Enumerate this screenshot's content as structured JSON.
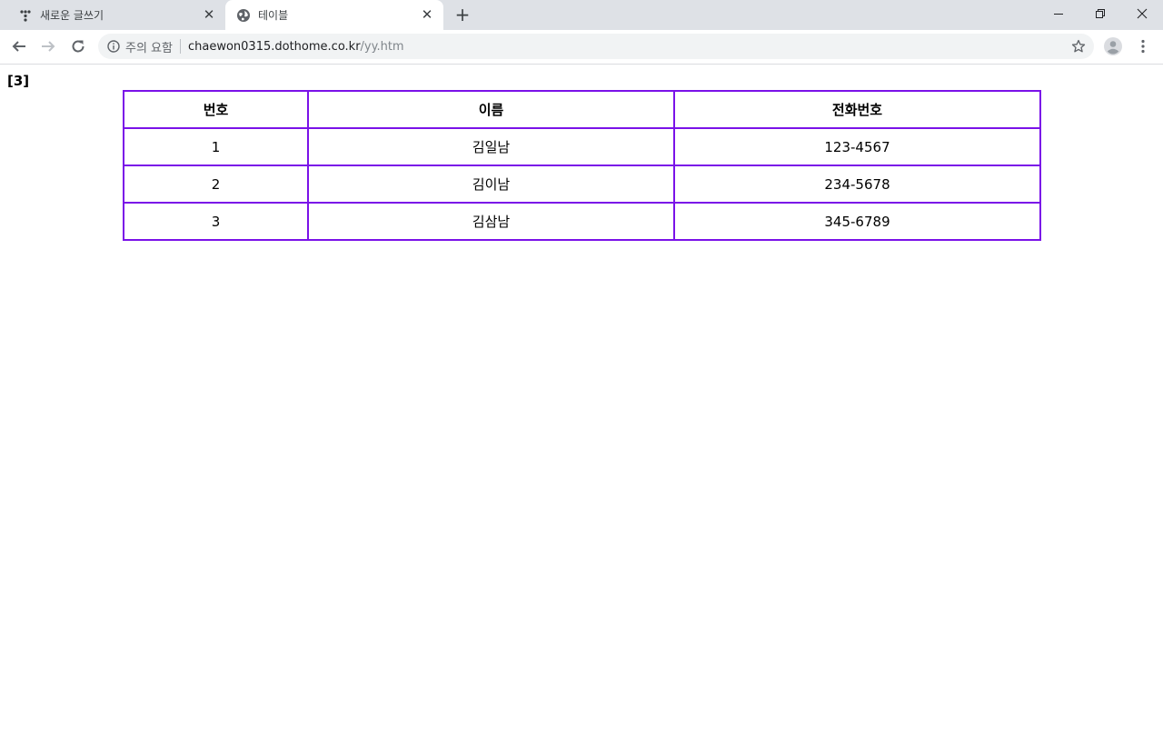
{
  "browser": {
    "tabs": [
      {
        "title": "새로운 글쓰기",
        "favicon": "tistory-icon",
        "active": false
      },
      {
        "title": "테이블",
        "favicon": "globe-icon",
        "active": true
      }
    ],
    "new_tab_label": "+",
    "url_security_text": "주의 요함",
    "url_host": "chaewon0315.dothome.co.kr",
    "url_path": "/yy.htm"
  },
  "page": {
    "label": "[3]",
    "table": {
      "headers": [
        "번호",
        "이름",
        "전화번호"
      ],
      "rows": [
        [
          "1",
          "김일남",
          "123-4567"
        ],
        [
          "2",
          "김이남",
          "234-5678"
        ],
        [
          "3",
          "김삼남",
          "345-6789"
        ]
      ],
      "border_color": "#7a12e8"
    }
  }
}
